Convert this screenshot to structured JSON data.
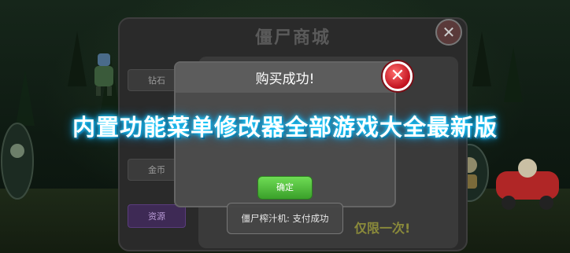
{
  "shop": {
    "title": "僵尸商城",
    "tabs": [
      {
        "label": "钻石",
        "active": false
      },
      {
        "label": "金币",
        "active": false
      },
      {
        "label": "资源",
        "active": true
      }
    ],
    "limit_text": "仅限一次!"
  },
  "dialog": {
    "title": "购买成功!",
    "confirm_label": "确定"
  },
  "toast": {
    "text": "僵尸榨汁机: 支付成功"
  },
  "banner": {
    "text": "内置功能菜单修改器全部游戏大全最新版"
  },
  "colors": {
    "banner_glow": "#1fd6ff",
    "confirm_green": "#4cbf36",
    "close_red": "#d62828"
  }
}
